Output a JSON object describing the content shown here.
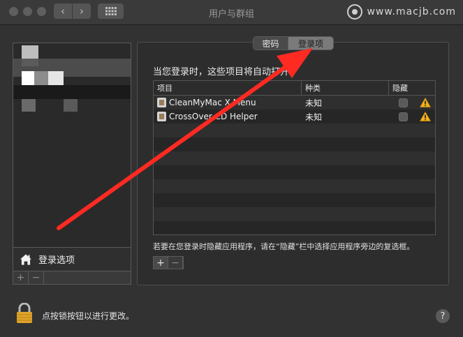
{
  "window": {
    "title": "用户与群组",
    "watermark": "www.macjb.com"
  },
  "toolbar": {
    "back_glyph": "‹",
    "forward_glyph": "›"
  },
  "users_panel": {
    "login_options_label": "登录选项",
    "add_glyph": "+",
    "remove_glyph": "−"
  },
  "tabs": [
    {
      "label": "密码",
      "selected": false
    },
    {
      "label": "登录项",
      "selected": true
    }
  ],
  "login_items": {
    "intro": "当您登录时，这些项目将自动打开：",
    "columns": {
      "item": "项目",
      "kind": "种类",
      "hide": "隐藏"
    },
    "rows": [
      {
        "name": "CleanMyMac X Menu",
        "kind": "未知",
        "hidden": false,
        "warning": true
      },
      {
        "name": "CrossOver CD Helper",
        "kind": "未知",
        "hidden": false,
        "warning": true
      }
    ],
    "help": "若要在您登录时隐藏应用程序，请在“隐藏”栏中选择应用程序旁边的复选框。",
    "add_glyph": "+",
    "remove_glyph": "−"
  },
  "footer": {
    "lock_text": "点按锁按钮以进行更改。",
    "help_glyph": "?"
  },
  "icons": {
    "lock": "lock-icon",
    "home": "house-icon",
    "warning": "warning-icon",
    "app": "app-icon"
  },
  "colors": {
    "annotation_arrow": "#ff2a22",
    "warning": "#f2b01e",
    "lock": "#e0a42a"
  }
}
